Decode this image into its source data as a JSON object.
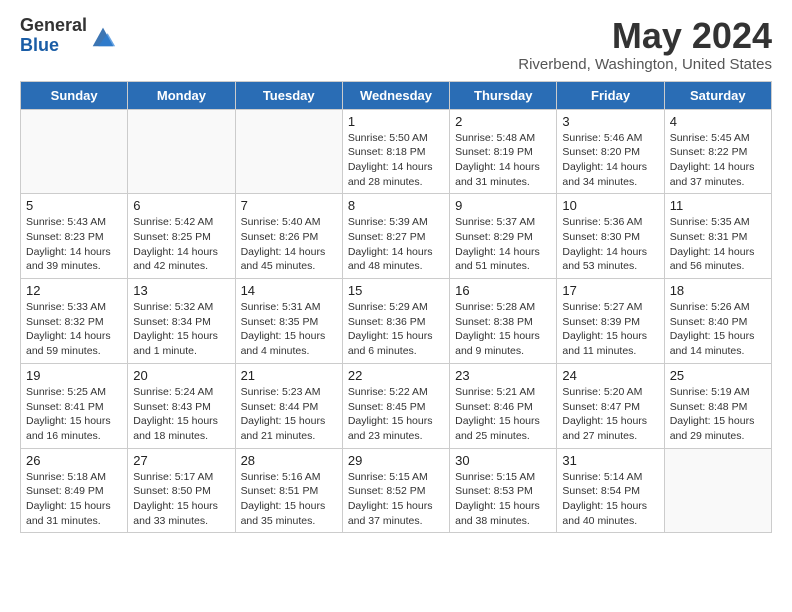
{
  "header": {
    "logo_general": "General",
    "logo_blue": "Blue",
    "month_title": "May 2024",
    "location": "Riverbend, Washington, United States"
  },
  "weekdays": [
    "Sunday",
    "Monday",
    "Tuesday",
    "Wednesday",
    "Thursday",
    "Friday",
    "Saturday"
  ],
  "weeks": [
    [
      {
        "day": "",
        "info": ""
      },
      {
        "day": "",
        "info": ""
      },
      {
        "day": "",
        "info": ""
      },
      {
        "day": "1",
        "info": "Sunrise: 5:50 AM\nSunset: 8:18 PM\nDaylight: 14 hours\nand 28 minutes."
      },
      {
        "day": "2",
        "info": "Sunrise: 5:48 AM\nSunset: 8:19 PM\nDaylight: 14 hours\nand 31 minutes."
      },
      {
        "day": "3",
        "info": "Sunrise: 5:46 AM\nSunset: 8:20 PM\nDaylight: 14 hours\nand 34 minutes."
      },
      {
        "day": "4",
        "info": "Sunrise: 5:45 AM\nSunset: 8:22 PM\nDaylight: 14 hours\nand 37 minutes."
      }
    ],
    [
      {
        "day": "5",
        "info": "Sunrise: 5:43 AM\nSunset: 8:23 PM\nDaylight: 14 hours\nand 39 minutes."
      },
      {
        "day": "6",
        "info": "Sunrise: 5:42 AM\nSunset: 8:25 PM\nDaylight: 14 hours\nand 42 minutes."
      },
      {
        "day": "7",
        "info": "Sunrise: 5:40 AM\nSunset: 8:26 PM\nDaylight: 14 hours\nand 45 minutes."
      },
      {
        "day": "8",
        "info": "Sunrise: 5:39 AM\nSunset: 8:27 PM\nDaylight: 14 hours\nand 48 minutes."
      },
      {
        "day": "9",
        "info": "Sunrise: 5:37 AM\nSunset: 8:29 PM\nDaylight: 14 hours\nand 51 minutes."
      },
      {
        "day": "10",
        "info": "Sunrise: 5:36 AM\nSunset: 8:30 PM\nDaylight: 14 hours\nand 53 minutes."
      },
      {
        "day": "11",
        "info": "Sunrise: 5:35 AM\nSunset: 8:31 PM\nDaylight: 14 hours\nand 56 minutes."
      }
    ],
    [
      {
        "day": "12",
        "info": "Sunrise: 5:33 AM\nSunset: 8:32 PM\nDaylight: 14 hours\nand 59 minutes."
      },
      {
        "day": "13",
        "info": "Sunrise: 5:32 AM\nSunset: 8:34 PM\nDaylight: 15 hours\nand 1 minute."
      },
      {
        "day": "14",
        "info": "Sunrise: 5:31 AM\nSunset: 8:35 PM\nDaylight: 15 hours\nand 4 minutes."
      },
      {
        "day": "15",
        "info": "Sunrise: 5:29 AM\nSunset: 8:36 PM\nDaylight: 15 hours\nand 6 minutes."
      },
      {
        "day": "16",
        "info": "Sunrise: 5:28 AM\nSunset: 8:38 PM\nDaylight: 15 hours\nand 9 minutes."
      },
      {
        "day": "17",
        "info": "Sunrise: 5:27 AM\nSunset: 8:39 PM\nDaylight: 15 hours\nand 11 minutes."
      },
      {
        "day": "18",
        "info": "Sunrise: 5:26 AM\nSunset: 8:40 PM\nDaylight: 15 hours\nand 14 minutes."
      }
    ],
    [
      {
        "day": "19",
        "info": "Sunrise: 5:25 AM\nSunset: 8:41 PM\nDaylight: 15 hours\nand 16 minutes."
      },
      {
        "day": "20",
        "info": "Sunrise: 5:24 AM\nSunset: 8:43 PM\nDaylight: 15 hours\nand 18 minutes."
      },
      {
        "day": "21",
        "info": "Sunrise: 5:23 AM\nSunset: 8:44 PM\nDaylight: 15 hours\nand 21 minutes."
      },
      {
        "day": "22",
        "info": "Sunrise: 5:22 AM\nSunset: 8:45 PM\nDaylight: 15 hours\nand 23 minutes."
      },
      {
        "day": "23",
        "info": "Sunrise: 5:21 AM\nSunset: 8:46 PM\nDaylight: 15 hours\nand 25 minutes."
      },
      {
        "day": "24",
        "info": "Sunrise: 5:20 AM\nSunset: 8:47 PM\nDaylight: 15 hours\nand 27 minutes."
      },
      {
        "day": "25",
        "info": "Sunrise: 5:19 AM\nSunset: 8:48 PM\nDaylight: 15 hours\nand 29 minutes."
      }
    ],
    [
      {
        "day": "26",
        "info": "Sunrise: 5:18 AM\nSunset: 8:49 PM\nDaylight: 15 hours\nand 31 minutes."
      },
      {
        "day": "27",
        "info": "Sunrise: 5:17 AM\nSunset: 8:50 PM\nDaylight: 15 hours\nand 33 minutes."
      },
      {
        "day": "28",
        "info": "Sunrise: 5:16 AM\nSunset: 8:51 PM\nDaylight: 15 hours\nand 35 minutes."
      },
      {
        "day": "29",
        "info": "Sunrise: 5:15 AM\nSunset: 8:52 PM\nDaylight: 15 hours\nand 37 minutes."
      },
      {
        "day": "30",
        "info": "Sunrise: 5:15 AM\nSunset: 8:53 PM\nDaylight: 15 hours\nand 38 minutes."
      },
      {
        "day": "31",
        "info": "Sunrise: 5:14 AM\nSunset: 8:54 PM\nDaylight: 15 hours\nand 40 minutes."
      },
      {
        "day": "",
        "info": ""
      }
    ]
  ]
}
